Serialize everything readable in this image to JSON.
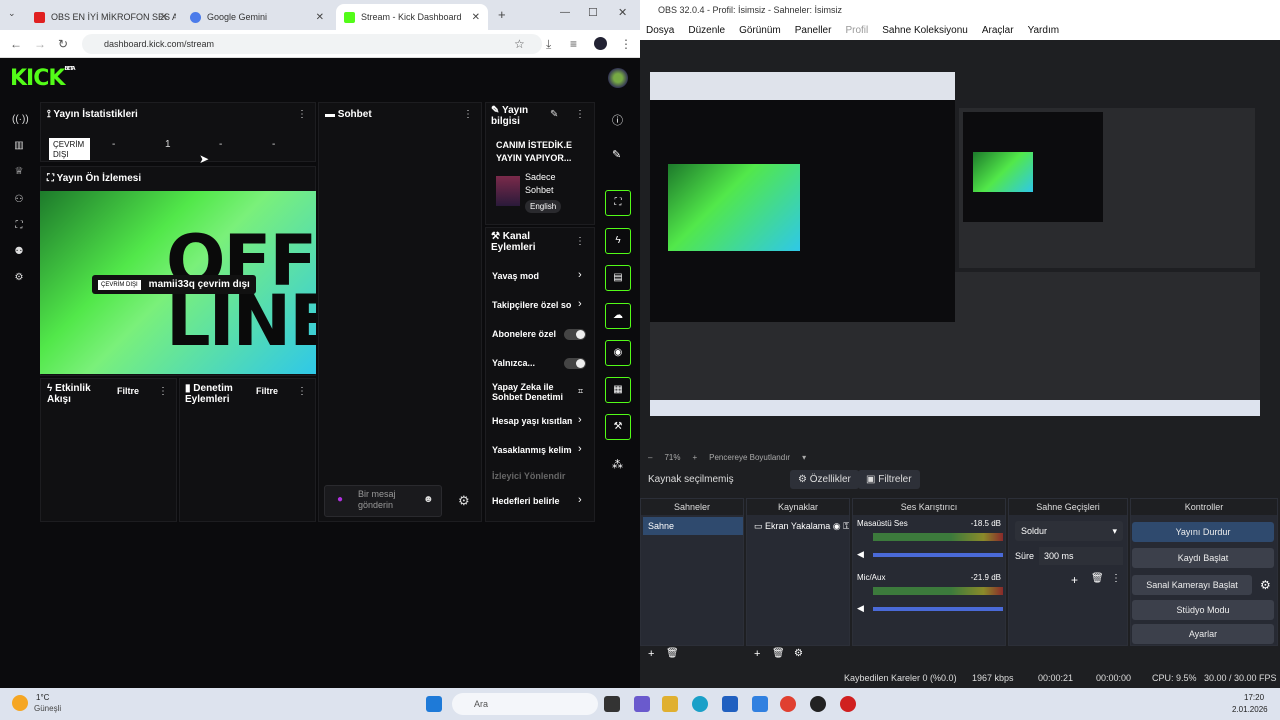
{
  "chrome": {
    "tabs": [
      {
        "label": "OBS EN İYİ MİKROFON SES AY"
      },
      {
        "label": "Google Gemini"
      },
      {
        "label": "Stream - Kick Dashboard"
      }
    ],
    "url": "dashboard.kick.com/stream"
  },
  "kick": {
    "logo": "KICK",
    "logo_badge": "BETA",
    "stats": {
      "title": "Yayın İstatistikleri",
      "badge": "ÇEVRİM DIŞI",
      "v1": "-",
      "v2": "1",
      "v3": "-",
      "v4": "-"
    },
    "preview": {
      "title": "Yayın Ön İzlemesi",
      "off_text": "OFF LINE",
      "chip_label": "ÇEVRİM DIŞI",
      "chip_text": "mamii33q çevrim dışı"
    },
    "activity": {
      "title": "Etkinlik Akışı",
      "filter": "Filtre"
    },
    "moderation": {
      "title": "Denetim Eylemleri",
      "filter": "Filtre"
    },
    "chat": {
      "title": "Sohbet",
      "placeholder": "Bir mesaj gönderin"
    },
    "stream_info": {
      "title": "Yayın bilgisi",
      "stream_title": "CANIM İSTEDİK.E YAYIN YAPIYOR...",
      "category": "Sadece Sohbet",
      "language": "English"
    },
    "channel_actions": {
      "title": "Kanal Eylemleri",
      "items": [
        {
          "label": "Yavaş mod"
        },
        {
          "label": "Takipçilere özel sohbet"
        },
        {
          "label": "Abonelere özel"
        },
        {
          "label": "Yalnızca..."
        },
        {
          "label": "Yapay Zeka ile Sohbet Denetimi"
        },
        {
          "label": "Hesap yaşı kısıtlaması"
        },
        {
          "label": "Yasaklanmış kelimeler"
        },
        {
          "label": "İzleyici Yönlendir"
        },
        {
          "label": "Hedefleri belirle"
        }
      ]
    }
  },
  "obs": {
    "title": "OBS 32.0.4 - Profil: İsimsiz - Sahneler: İsimsiz",
    "menu": [
      "Dosya",
      "Düzenle",
      "Görünüm",
      "Paneller",
      "Profil",
      "Sahne Koleksiyonu",
      "Araçlar",
      "Yardım"
    ],
    "zoom": "71%",
    "fit": "Pencereye Boyutlandır",
    "no_source": "Kaynak seçilmemiş",
    "properties": "Özellikler",
    "filters": "Filtreler",
    "panels": {
      "scenes": "Sahneler",
      "sources": "Kaynaklar",
      "mixer": "Ses Karıştırıcı",
      "transitions": "Sahne Geçişleri",
      "controls": "Kontroller"
    },
    "scene": "Sahne",
    "source": "Ekran Yakalama",
    "mixer": [
      {
        "name": "Masaüstü Ses",
        "db": "-18.5 dB"
      },
      {
        "name": "Mic/Aux",
        "db": "-21.9 dB"
      }
    ],
    "transition": "Soldur",
    "duration_label": "Süre",
    "duration": "300 ms",
    "controls": [
      "Yayını Durdur",
      "Kaydı Başlat",
      "Sanal Kamerayı Başlat",
      "Stüdyo Modu",
      "Ayarlar"
    ],
    "status": {
      "dropped": "Kaybedilen Kareler 0 (%0.0)",
      "kbps": "1967 kbps",
      "time1": "00:00:21",
      "time2": "00:00:00",
      "cpu": "CPU: 9.5%",
      "fps": "30.00 / 30.00 FPS"
    }
  },
  "taskbar": {
    "weather_temp": "1°C",
    "weather_text": "Güneşli",
    "search": "Ara",
    "time": "17:20",
    "date": "2.01.2026"
  }
}
